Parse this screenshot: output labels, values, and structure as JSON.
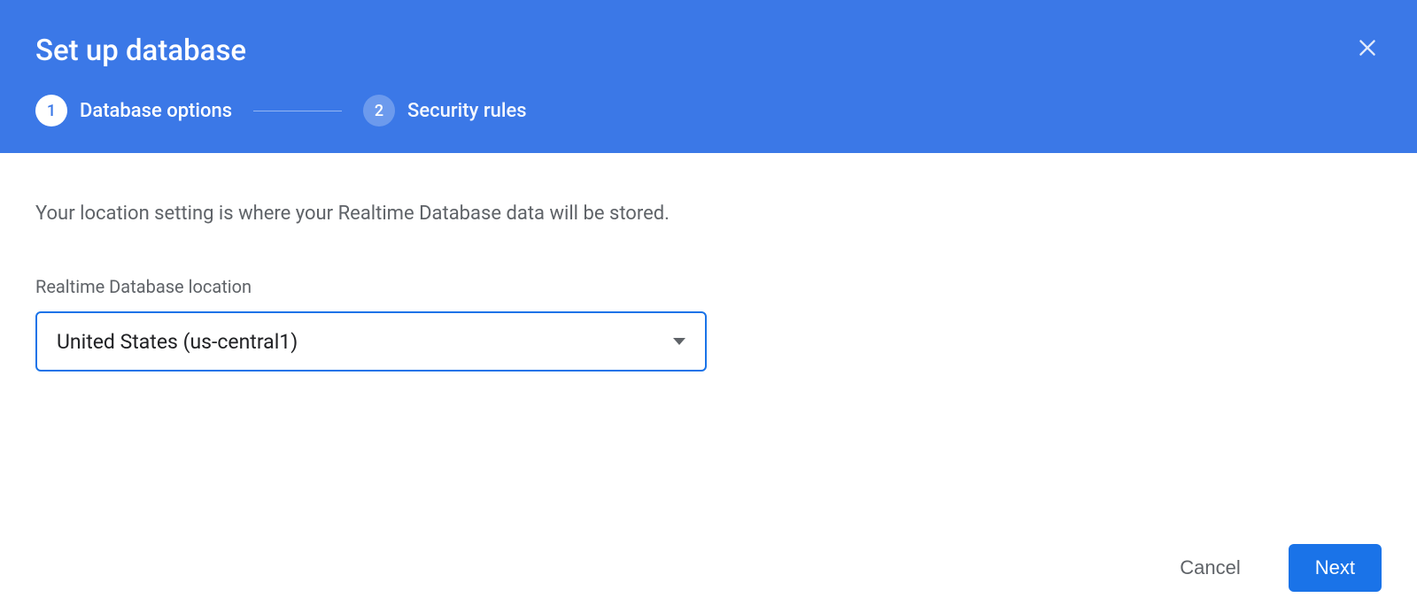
{
  "header": {
    "title": "Set up database",
    "steps": [
      {
        "number": "1",
        "label": "Database options",
        "active": true
      },
      {
        "number": "2",
        "label": "Security rules",
        "active": false
      }
    ]
  },
  "content": {
    "description": "Your location setting is where your Realtime Database data will be stored.",
    "location_field_label": "Realtime Database location",
    "location_selected_value": "United States (us-central1)"
  },
  "footer": {
    "cancel_label": "Cancel",
    "next_label": "Next"
  }
}
